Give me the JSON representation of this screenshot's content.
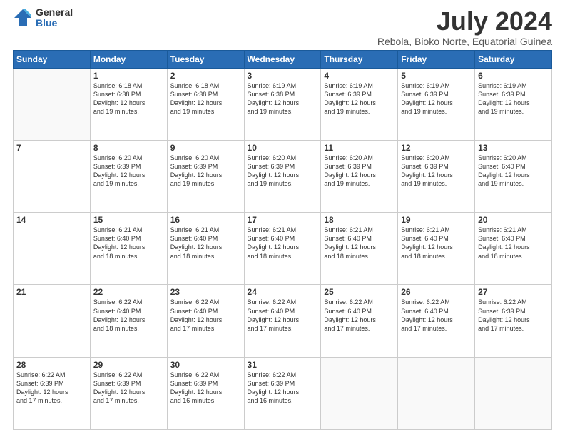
{
  "logo": {
    "general": "General",
    "blue": "Blue"
  },
  "title": "July 2024",
  "subtitle": "Rebola, Bioko Norte, Equatorial Guinea",
  "weekdays": [
    "Sunday",
    "Monday",
    "Tuesday",
    "Wednesday",
    "Thursday",
    "Friday",
    "Saturday"
  ],
  "weeks": [
    [
      {
        "day": "",
        "info": ""
      },
      {
        "day": "1",
        "info": "Sunrise: 6:18 AM\nSunset: 6:38 PM\nDaylight: 12 hours\nand 19 minutes."
      },
      {
        "day": "2",
        "info": "Sunrise: 6:18 AM\nSunset: 6:38 PM\nDaylight: 12 hours\nand 19 minutes."
      },
      {
        "day": "3",
        "info": "Sunrise: 6:19 AM\nSunset: 6:38 PM\nDaylight: 12 hours\nand 19 minutes."
      },
      {
        "day": "4",
        "info": "Sunrise: 6:19 AM\nSunset: 6:39 PM\nDaylight: 12 hours\nand 19 minutes."
      },
      {
        "day": "5",
        "info": "Sunrise: 6:19 AM\nSunset: 6:39 PM\nDaylight: 12 hours\nand 19 minutes."
      },
      {
        "day": "6",
        "info": "Sunrise: 6:19 AM\nSunset: 6:39 PM\nDaylight: 12 hours\nand 19 minutes."
      }
    ],
    [
      {
        "day": "7",
        "info": ""
      },
      {
        "day": "8",
        "info": "Sunrise: 6:20 AM\nSunset: 6:39 PM\nDaylight: 12 hours\nand 19 minutes."
      },
      {
        "day": "9",
        "info": "Sunrise: 6:20 AM\nSunset: 6:39 PM\nDaylight: 12 hours\nand 19 minutes."
      },
      {
        "day": "10",
        "info": "Sunrise: 6:20 AM\nSunset: 6:39 PM\nDaylight: 12 hours\nand 19 minutes."
      },
      {
        "day": "11",
        "info": "Sunrise: 6:20 AM\nSunset: 6:39 PM\nDaylight: 12 hours\nand 19 minutes."
      },
      {
        "day": "12",
        "info": "Sunrise: 6:20 AM\nSunset: 6:39 PM\nDaylight: 12 hours\nand 19 minutes."
      },
      {
        "day": "13",
        "info": "Sunrise: 6:20 AM\nSunset: 6:40 PM\nDaylight: 12 hours\nand 19 minutes."
      }
    ],
    [
      {
        "day": "14",
        "info": ""
      },
      {
        "day": "15",
        "info": "Sunrise: 6:21 AM\nSunset: 6:40 PM\nDaylight: 12 hours\nand 18 minutes."
      },
      {
        "day": "16",
        "info": "Sunrise: 6:21 AM\nSunset: 6:40 PM\nDaylight: 12 hours\nand 18 minutes."
      },
      {
        "day": "17",
        "info": "Sunrise: 6:21 AM\nSunset: 6:40 PM\nDaylight: 12 hours\nand 18 minutes."
      },
      {
        "day": "18",
        "info": "Sunrise: 6:21 AM\nSunset: 6:40 PM\nDaylight: 12 hours\nand 18 minutes."
      },
      {
        "day": "19",
        "info": "Sunrise: 6:21 AM\nSunset: 6:40 PM\nDaylight: 12 hours\nand 18 minutes."
      },
      {
        "day": "20",
        "info": "Sunrise: 6:21 AM\nSunset: 6:40 PM\nDaylight: 12 hours\nand 18 minutes."
      }
    ],
    [
      {
        "day": "21",
        "info": ""
      },
      {
        "day": "22",
        "info": "Sunrise: 6:22 AM\nSunset: 6:40 PM\nDaylight: 12 hours\nand 18 minutes."
      },
      {
        "day": "23",
        "info": "Sunrise: 6:22 AM\nSunset: 6:40 PM\nDaylight: 12 hours\nand 17 minutes."
      },
      {
        "day": "24",
        "info": "Sunrise: 6:22 AM\nSunset: 6:40 PM\nDaylight: 12 hours\nand 17 minutes."
      },
      {
        "day": "25",
        "info": "Sunrise: 6:22 AM\nSunset: 6:40 PM\nDaylight: 12 hours\nand 17 minutes."
      },
      {
        "day": "26",
        "info": "Sunrise: 6:22 AM\nSunset: 6:40 PM\nDaylight: 12 hours\nand 17 minutes."
      },
      {
        "day": "27",
        "info": "Sunrise: 6:22 AM\nSunset: 6:39 PM\nDaylight: 12 hours\nand 17 minutes."
      }
    ],
    [
      {
        "day": "28",
        "info": "Sunrise: 6:22 AM\nSunset: 6:39 PM\nDaylight: 12 hours\nand 17 minutes."
      },
      {
        "day": "29",
        "info": "Sunrise: 6:22 AM\nSunset: 6:39 PM\nDaylight: 12 hours\nand 17 minutes."
      },
      {
        "day": "30",
        "info": "Sunrise: 6:22 AM\nSunset: 6:39 PM\nDaylight: 12 hours\nand 16 minutes."
      },
      {
        "day": "31",
        "info": "Sunrise: 6:22 AM\nSunset: 6:39 PM\nDaylight: 12 hours\nand 16 minutes."
      },
      {
        "day": "",
        "info": ""
      },
      {
        "day": "",
        "info": ""
      },
      {
        "day": "",
        "info": ""
      }
    ]
  ]
}
